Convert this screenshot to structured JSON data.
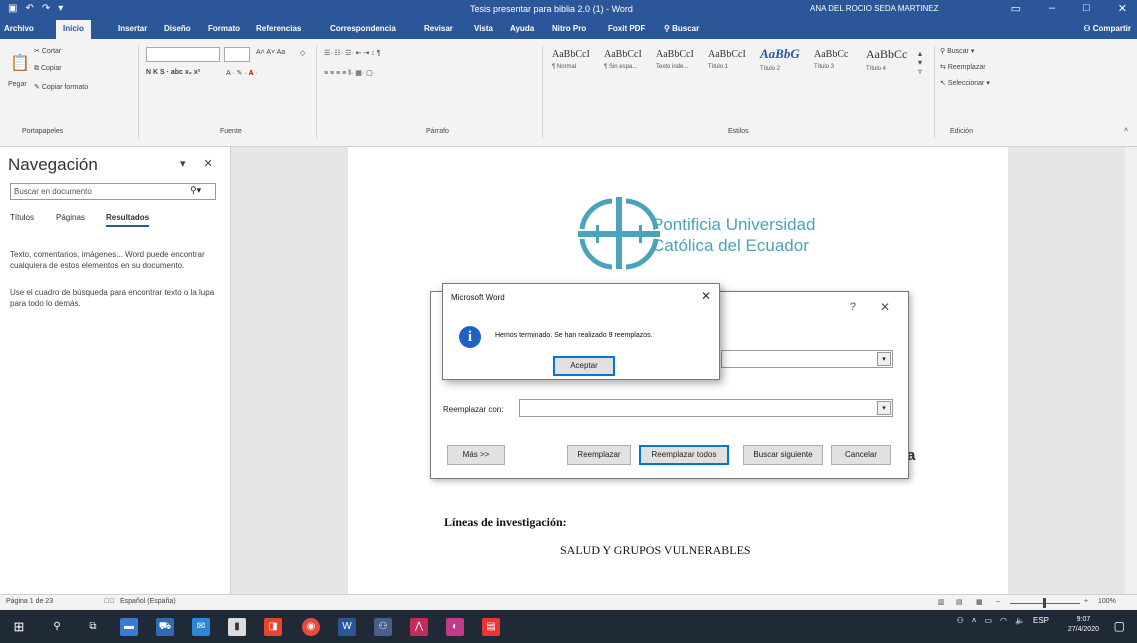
{
  "window": {
    "title": "Tesis presentar para biblia 2.0 (1) - Word",
    "user": "ANA DEL ROCIO SEDA MARTINEZ"
  },
  "tabs": [
    "Archivo",
    "Inicio",
    "Insertar",
    "Diseño",
    "Formato",
    "Referencias",
    "Correspondencia",
    "Revisar",
    "Vista",
    "Ayuda",
    "Nitro Pro",
    "Foxit PDF",
    "Buscar"
  ],
  "share_label": "Compartir",
  "ribbon": {
    "clipboard": {
      "paste": "Pegar",
      "cut": "Cortar",
      "copy": "Copiar",
      "format_painter": "Copiar formato",
      "label": "Portapapeles"
    },
    "font": {
      "label": "Fuente",
      "buttons": "N  K  S  ·  abc  x₂  x²"
    },
    "paragraph": {
      "label": "Párrafo"
    },
    "styles": {
      "label": "Estilos",
      "items": [
        {
          "sample": "AaBbCcI",
          "name": "¶ Normal"
        },
        {
          "sample": "AaBbCcI",
          "name": "¶ Sin espa..."
        },
        {
          "sample": "AaBbCcI",
          "name": "Texto inde..."
        },
        {
          "sample": "AaBbCcI",
          "name": "Título 1"
        },
        {
          "sample": "AaBbG",
          "name": "Título 2"
        },
        {
          "sample": "AaBbCc",
          "name": "Título 3"
        },
        {
          "sample": "AaBbCc",
          "name": "Título 4"
        }
      ]
    },
    "editing": {
      "label": "Edición",
      "find": "Buscar",
      "replace": "Reemplazar",
      "select": "Seleccionar"
    }
  },
  "nav": {
    "title": "Navegación",
    "search_placeholder": "Buscar en documento",
    "tabs": [
      "Títulos",
      "Páginas",
      "Resultados"
    ],
    "text1": "Texto, comentarios, imágenes... Word puede encontrar cualquiera de estos elementos en su documento.",
    "text2": "Use el cuadro de búsqueda para encontrar texto o la lupa para todo lo demás."
  },
  "document": {
    "university_line1": "Pontificia Universidad",
    "university_line2": "Católica del Ecuador",
    "lineas": "Líneas de investigación:",
    "salud": "SALUD Y GRUPOS VULNERABLES",
    "partial": "a"
  },
  "find_replace": {
    "help": "?",
    "replace_with_label": "Reemplazar con:",
    "more_button": "Más >>",
    "replace_button": "Reemplazar",
    "replace_all_button": "Reemplazar todos",
    "find_next_button": "Buscar siguiente",
    "cancel_button": "Cancelar"
  },
  "message_box": {
    "title": "Microsoft Word",
    "text": "Hemos terminado. Se han realizado 9 reemplazos.",
    "ok_button": "Aceptar"
  },
  "status": {
    "page": "Página 1 de 23",
    "language": "Español (España)",
    "zoom": "100%"
  },
  "taskbar": {
    "time": "9:07",
    "date": "27/4/2020",
    "lang": "ESP"
  },
  "colors": {
    "word_blue": "#2b579a",
    "pucе_teal": "#4aa3b8",
    "info_blue": "#1e62c6"
  }
}
